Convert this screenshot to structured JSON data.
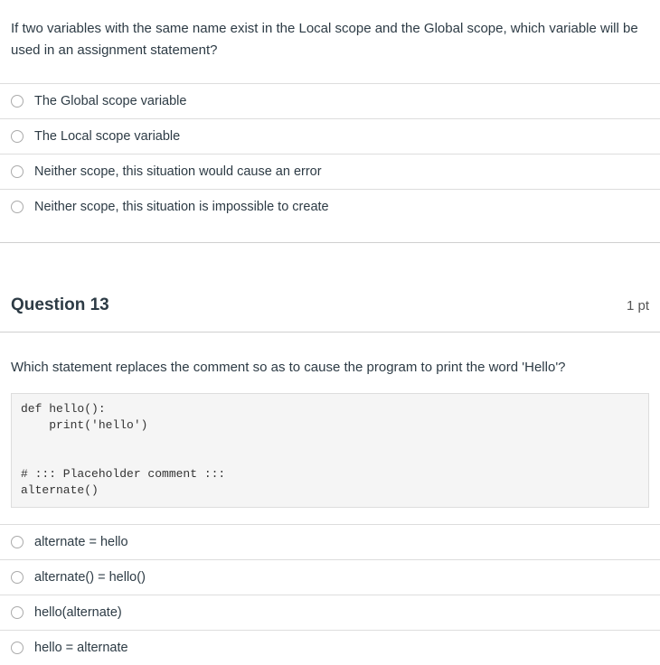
{
  "question12": {
    "text": "If two variables with the same name exist in the Local scope and the Global scope, which variable will be used in an assignment statement?",
    "options": [
      "The Global scope variable",
      "The Local scope variable",
      "Neither scope, this situation would cause an error",
      "Neither scope, this situation is impossible to create"
    ]
  },
  "question13": {
    "title": "Question 13",
    "points": "1 pt",
    "text": "Which statement replaces the comment so as to cause the program to print the word 'Hello'?",
    "code": "def hello():\n    print('hello')\n\n\n# ::: Placeholder comment :::\nalternate()",
    "options": [
      "alternate = hello",
      "alternate() = hello()",
      "hello(alternate)",
      "hello = alternate"
    ]
  }
}
